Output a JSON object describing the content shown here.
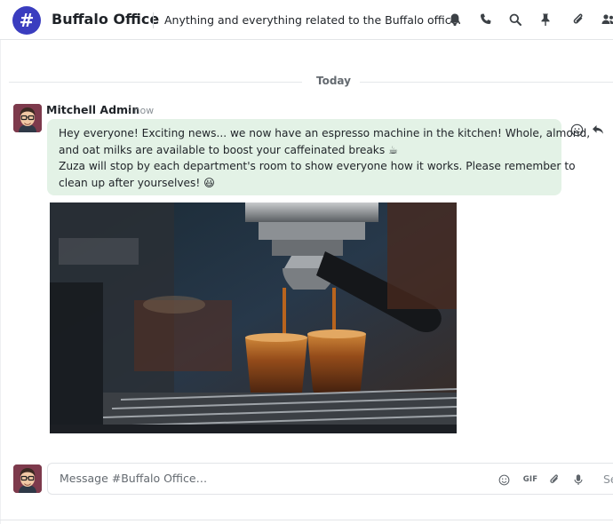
{
  "header": {
    "channel_symbol": "#",
    "channel_name": "Buffalo Office",
    "channel_description": "Anything and everything related to the Buffalo office.",
    "icons": [
      "bell-icon",
      "phone-icon",
      "search-icon",
      "pin-icon",
      "paperclip-icon",
      "members-icon"
    ]
  },
  "thread": {
    "date_separator": "Today",
    "message": {
      "author": "Mitchell Admin",
      "timestamp": "- now",
      "lines": [
        "Hey everyone! Exciting news... we now have an espresso machine in the kitchen! Whole, almond,",
        "and oat milks are available to boost your caffeinated breaks ☕",
        "Zuza will stop by each department's room to show everyone how it works. Please remember to",
        "clean up after yourselves! 😃"
      ],
      "actions": [
        "smiley-icon",
        "reply-icon"
      ],
      "attachment": "espresso-photo"
    }
  },
  "composer": {
    "placeholder": "Message #Buffalo Office…",
    "gif_label": "GIF",
    "send_label": "Se",
    "icons": [
      "emoji-icon",
      "gif-icon",
      "attach-icon",
      "microphone-icon"
    ]
  },
  "colors": {
    "accent": "#3a3dbf",
    "bubble_bg": "#e3f2e6",
    "muted_text": "#8a9096"
  }
}
